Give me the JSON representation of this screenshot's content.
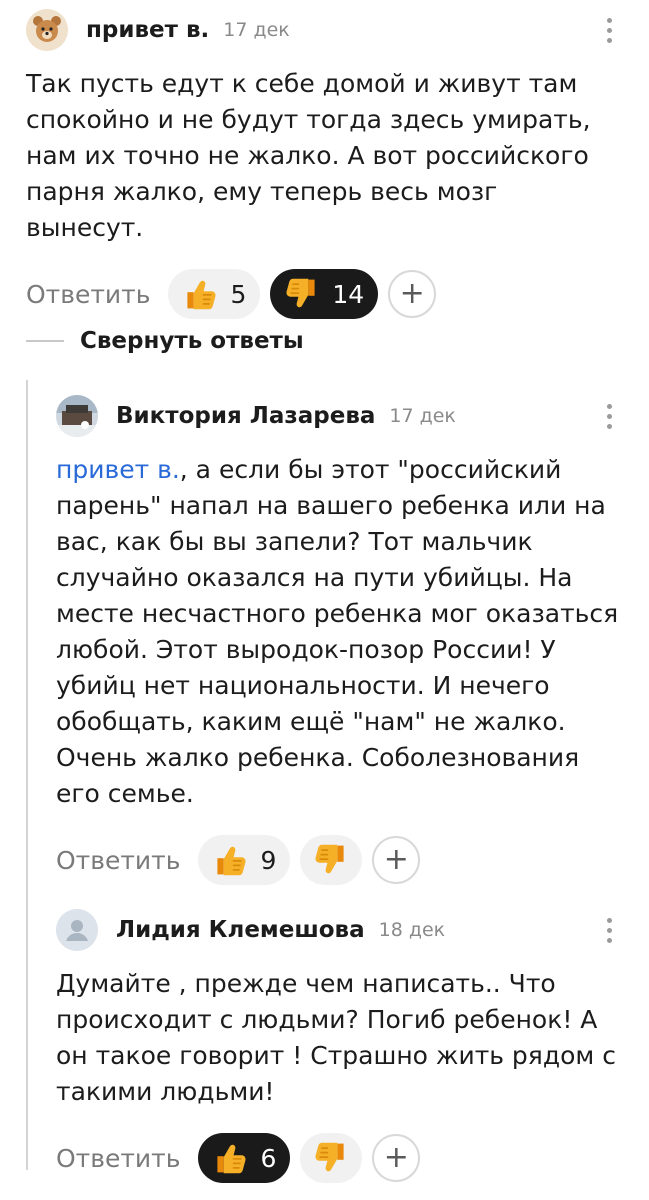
{
  "comments": [
    {
      "author": "привет в.",
      "date": "17 дек",
      "text": "Так пусть едут к себе домой и живут там спокойно и не будут тогда здесь умирать, нам их точно не жалко. А вот российского парня жалко, ему теперь весь мозг вынесут.",
      "reply_label": "Ответить",
      "likes": "5",
      "dislikes": "14",
      "avatar": "bear-avatar"
    },
    {
      "author": "Виктория Лазарева",
      "date": "17 дек",
      "mention": "привет в.",
      "text": ", а если бы этот \"российский парень\" напал на вашего ребенка или на вас, как бы вы запели? Тот мальчик случайно оказался на пути убийцы. На месте несчастного ребенка мог оказаться любой. Этот выродок-позор России! У убийц нет национальности. И нечего обобщать, каким ещё \"нам\" не жалко. Очень жалко ребенка. Соболезнования его семье.",
      "reply_label": "Ответить",
      "likes": "9",
      "avatar": "photo-avatar"
    },
    {
      "author": "Лидия Клемешова",
      "date": "18 дек",
      "text": "Думайте , прежде чем написать.. Что происходит с людьми? Погиб ребенок! А он такое говорит ! Страшно жить рядом с такими людьми!",
      "reply_label": "Ответить",
      "likes": "6",
      "avatar": "default-user-avatar"
    }
  ],
  "collapse_label": "Свернуть ответы",
  "plus_label": "+",
  "colors": {
    "mention": "#2a6ad8",
    "dark_pill": "#1a1a1a",
    "pill": "#f1f1f1",
    "thumb": "#f5a623"
  }
}
